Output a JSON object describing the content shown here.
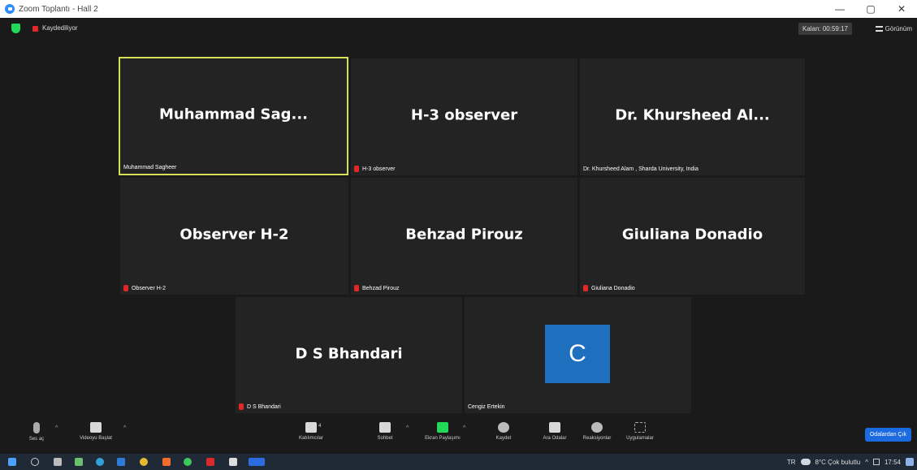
{
  "window": {
    "title": "Zoom Toplantı - Hall 2",
    "minimize": "—",
    "maximize": "▢",
    "close": "✕"
  },
  "topbar": {
    "recording_label": "Kaydediliyor",
    "timer": "Kalan: 00:59:17",
    "view_label": "Görünüm"
  },
  "tiles": [
    {
      "big": "Muhammad  Sag...",
      "name": "Muhammad Sagheer",
      "muted": false,
      "active": true
    },
    {
      "big": "H-3 observer",
      "name": "H-3 observer",
      "muted": true,
      "active": false
    },
    {
      "big": "Dr. Khursheed Al...",
      "name": "Dr. Khursheed Alam , Sharda University, India",
      "muted": false,
      "active": false
    },
    {
      "big": "Observer H-2",
      "name": "Observer H-2",
      "muted": true,
      "active": false
    },
    {
      "big": "Behzad Pirouz",
      "name": "Behzad Pirouz",
      "muted": true,
      "active": false
    },
    {
      "big": "Giuliana Donadio",
      "name": "Giuliana Donadio",
      "muted": true,
      "active": false
    },
    {
      "big": "D S Bhandari",
      "name": "D S Bhandari",
      "muted": true,
      "active": false
    },
    {
      "big": "",
      "name": "Cengiz Ertekin",
      "avatar": "C",
      "muted": false,
      "active": false
    }
  ],
  "controls": {
    "audio": "Ses aç",
    "video": "Videoyu Başlat",
    "participants": "Katılımcılar",
    "participants_count": "4",
    "chat": "Sohbet",
    "share": "Ekran Paylaşımı",
    "record": "Kaydet",
    "breakout": "Ara Odalar",
    "reactions": "Reaksiyonlar",
    "apps": "Uygulamalar",
    "leave": "Odalardan Çık"
  },
  "taskbar": {
    "lang": "TR",
    "weather": "8°C  Çok bulutlu",
    "time": "17:54"
  },
  "colors": {
    "active_border": "#d4e157",
    "share_green": "#23d959",
    "leave_blue": "#1c6ae0",
    "avatar_blue": "#1e6fbd",
    "muted_red": "#e02828"
  }
}
